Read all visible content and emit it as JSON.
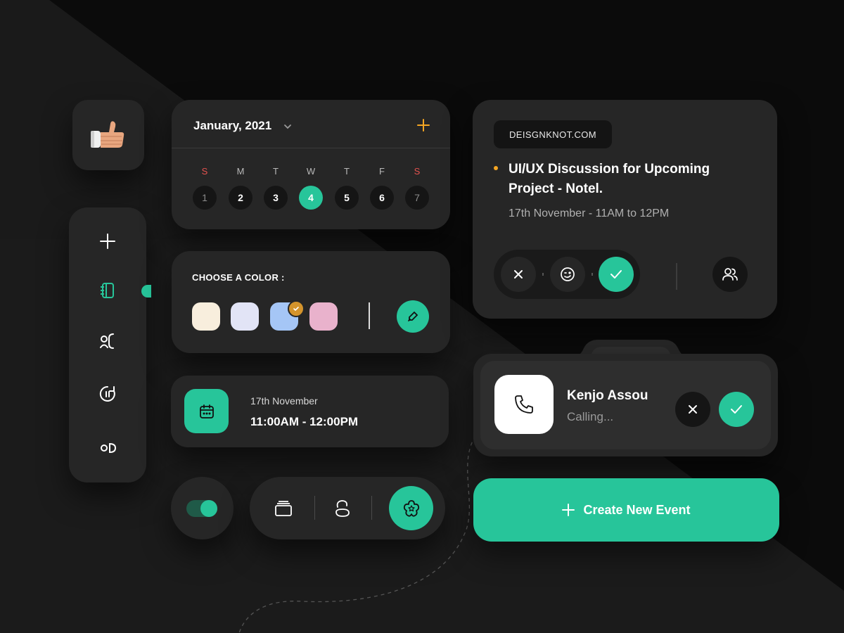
{
  "calendar": {
    "month_label": "January, 2021",
    "days": [
      {
        "dow": "S",
        "num": "1",
        "weekend": true
      },
      {
        "dow": "M",
        "num": "2",
        "weekend": false
      },
      {
        "dow": "T",
        "num": "3",
        "weekend": false
      },
      {
        "dow": "W",
        "num": "4",
        "weekend": false,
        "selected": true
      },
      {
        "dow": "T",
        "num": "5",
        "weekend": false
      },
      {
        "dow": "F",
        "num": "6",
        "weekend": false
      },
      {
        "dow": "S",
        "num": "7",
        "weekend": true
      }
    ]
  },
  "color_picker": {
    "label": "CHOOSE A COLOR :",
    "swatches": [
      "#f8eedd",
      "#e2e4f6",
      "#a5c6f6",
      "#e9b2cc"
    ],
    "selected_index": 2
  },
  "time_card": {
    "date": "17th November",
    "time_range": "11:00AM - 12:00PM"
  },
  "event": {
    "tag": "DEISGNKNOT.COM",
    "title_line1": "UI/UX Discussion for Upcoming",
    "title_line2": "Project - Notel.",
    "schedule": "17th November - 11AM to 12PM"
  },
  "call": {
    "caller_name": "Kenjo Assou",
    "status": "Calling..."
  },
  "create_button": {
    "label": "Create New Event"
  },
  "icons": {
    "thumb": "thumbs-up-icon",
    "sidebar": [
      "plus-icon",
      "notebook-icon",
      "contacts-icon",
      "timer-icon",
      "toggle-icon"
    ],
    "nav": [
      "cards-icon",
      "bean-icon",
      "flower-star-icon"
    ]
  },
  "colors": {
    "accent": "#27c59a",
    "card": "#262626",
    "background": "#0b0b0b",
    "warning": "#e4524f",
    "orange": "#f5a623"
  },
  "toggle": {
    "on": true
  }
}
